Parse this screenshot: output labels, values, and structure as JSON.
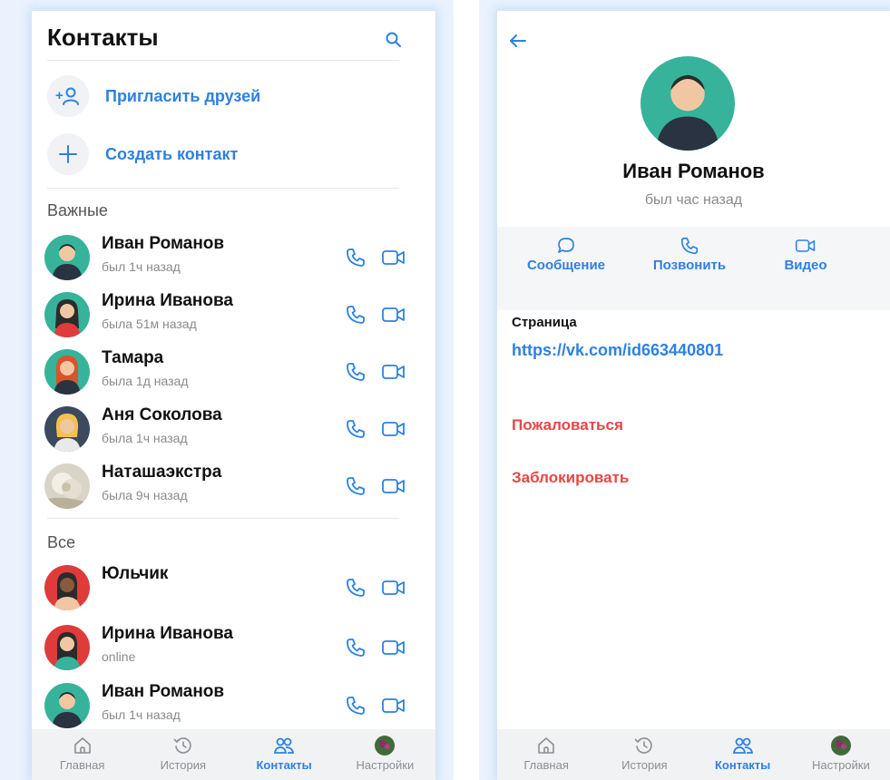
{
  "contacts_screen": {
    "title": "Контакты",
    "invite_label": "Пригласить друзей",
    "create_label": "Создать контакт",
    "important_title": "Важные",
    "all_title": "Все",
    "important": [
      {
        "name": "Иван Романов",
        "status": "был 1ч назад"
      },
      {
        "name": "Ирина Иванова",
        "status": "была 51м назад"
      },
      {
        "name": "Тамара",
        "status": "была 1д назад"
      },
      {
        "name": "Аня Соколова",
        "status": "была 1ч назад"
      },
      {
        "name": "Наташаэкстра",
        "status": "была 9ч назад"
      }
    ],
    "all": [
      {
        "name": "Юльчик",
        "status": ""
      },
      {
        "name": "Ирина Иванова",
        "status": "online"
      },
      {
        "name": "Иван Романов",
        "status": "был 1ч назад"
      }
    ]
  },
  "profile_screen": {
    "name": "Иван Романов",
    "status": "был час назад",
    "message_label": "Сообщение",
    "call_label": "Позвонить",
    "video_label": "Видео",
    "page_label": "Страница",
    "page_link": "https://vk.com/id663440801",
    "report_label": "Пожаловаться",
    "block_label": "Заблокировать"
  },
  "tabbar": {
    "home": "Главная",
    "history": "История",
    "contacts": "Контакты",
    "settings": "Настройки"
  },
  "colors": {
    "accent": "#2d81e0",
    "danger": "#e64646",
    "muted": "#8a8a8a"
  },
  "icons": [
    "search-icon",
    "add-user-icon",
    "plus-icon",
    "phone-icon",
    "video-icon",
    "home-icon",
    "history-icon",
    "contacts-icon",
    "back-arrow-icon",
    "message-icon"
  ]
}
